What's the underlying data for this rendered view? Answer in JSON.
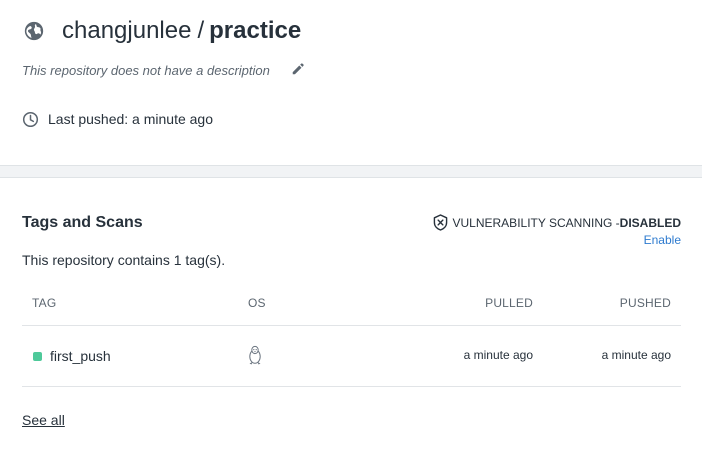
{
  "repository": {
    "namespace": "changjunlee",
    "separator": "/",
    "name": "practice",
    "description": "This repository does not have a description",
    "last_pushed": "Last pushed: a minute ago"
  },
  "tags_section": {
    "title": "Tags and Scans",
    "vulnerability_label": "VULNERABILITY SCANNING - ",
    "vulnerability_status": "DISABLED",
    "enable_link": "Enable",
    "tag_count_text": "This repository contains 1 tag(s).",
    "columns": {
      "tag": "TAG",
      "os": "OS",
      "pulled": "PULLED",
      "pushed": "PUSHED"
    },
    "rows": [
      {
        "tag": "first_push",
        "os_icon": "linux-icon",
        "pulled": "a minute ago",
        "pushed": "a minute ago",
        "status_color": "#4ec99a"
      }
    ],
    "see_all": "See all"
  },
  "icons": {
    "header": "globe-icon",
    "edit": "pencil-icon",
    "last_pushed": "clock-icon",
    "vulnerability": "shield-x-icon"
  },
  "colors": {
    "link": "#2e7bcf",
    "status_ok": "#4ec99a",
    "text": "#27313b",
    "muted": "#5c6670"
  }
}
